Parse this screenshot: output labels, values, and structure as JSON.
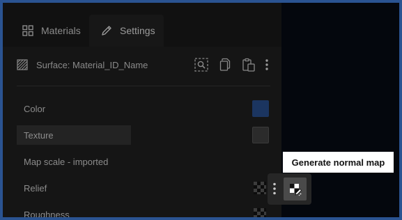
{
  "tabs": {
    "materials": {
      "label": "Materials",
      "icon": "grid-icon"
    },
    "settings": {
      "label": "Settings",
      "icon": "pencil-icon",
      "active": true
    }
  },
  "surface": {
    "label": "Surface: Material_ID_Name",
    "icon": "hatch-icon",
    "tools": [
      "search-frame-icon",
      "copy-icon",
      "paste-icon",
      "more-vertical-icon"
    ]
  },
  "properties": [
    {
      "label": "Color",
      "control": "swatch",
      "swatch_color": "#1b3560"
    },
    {
      "label": "Texture",
      "control": "swatch",
      "swatch_color": "#2b2b2b"
    },
    {
      "label": "Map scale - imported",
      "control": "none"
    },
    {
      "label": "Relief",
      "control": "checker"
    },
    {
      "label": "Roughness",
      "control": "checker"
    }
  ],
  "tooltip": {
    "text": "Generate normal map"
  },
  "popover": {
    "button_icon": "generate-normal-map-icon",
    "menu_icon": "more-vertical-icon"
  },
  "colors": {
    "frame": "#2a5391",
    "panel": "#151515",
    "background": "#04070d",
    "highlight": "#232323"
  }
}
